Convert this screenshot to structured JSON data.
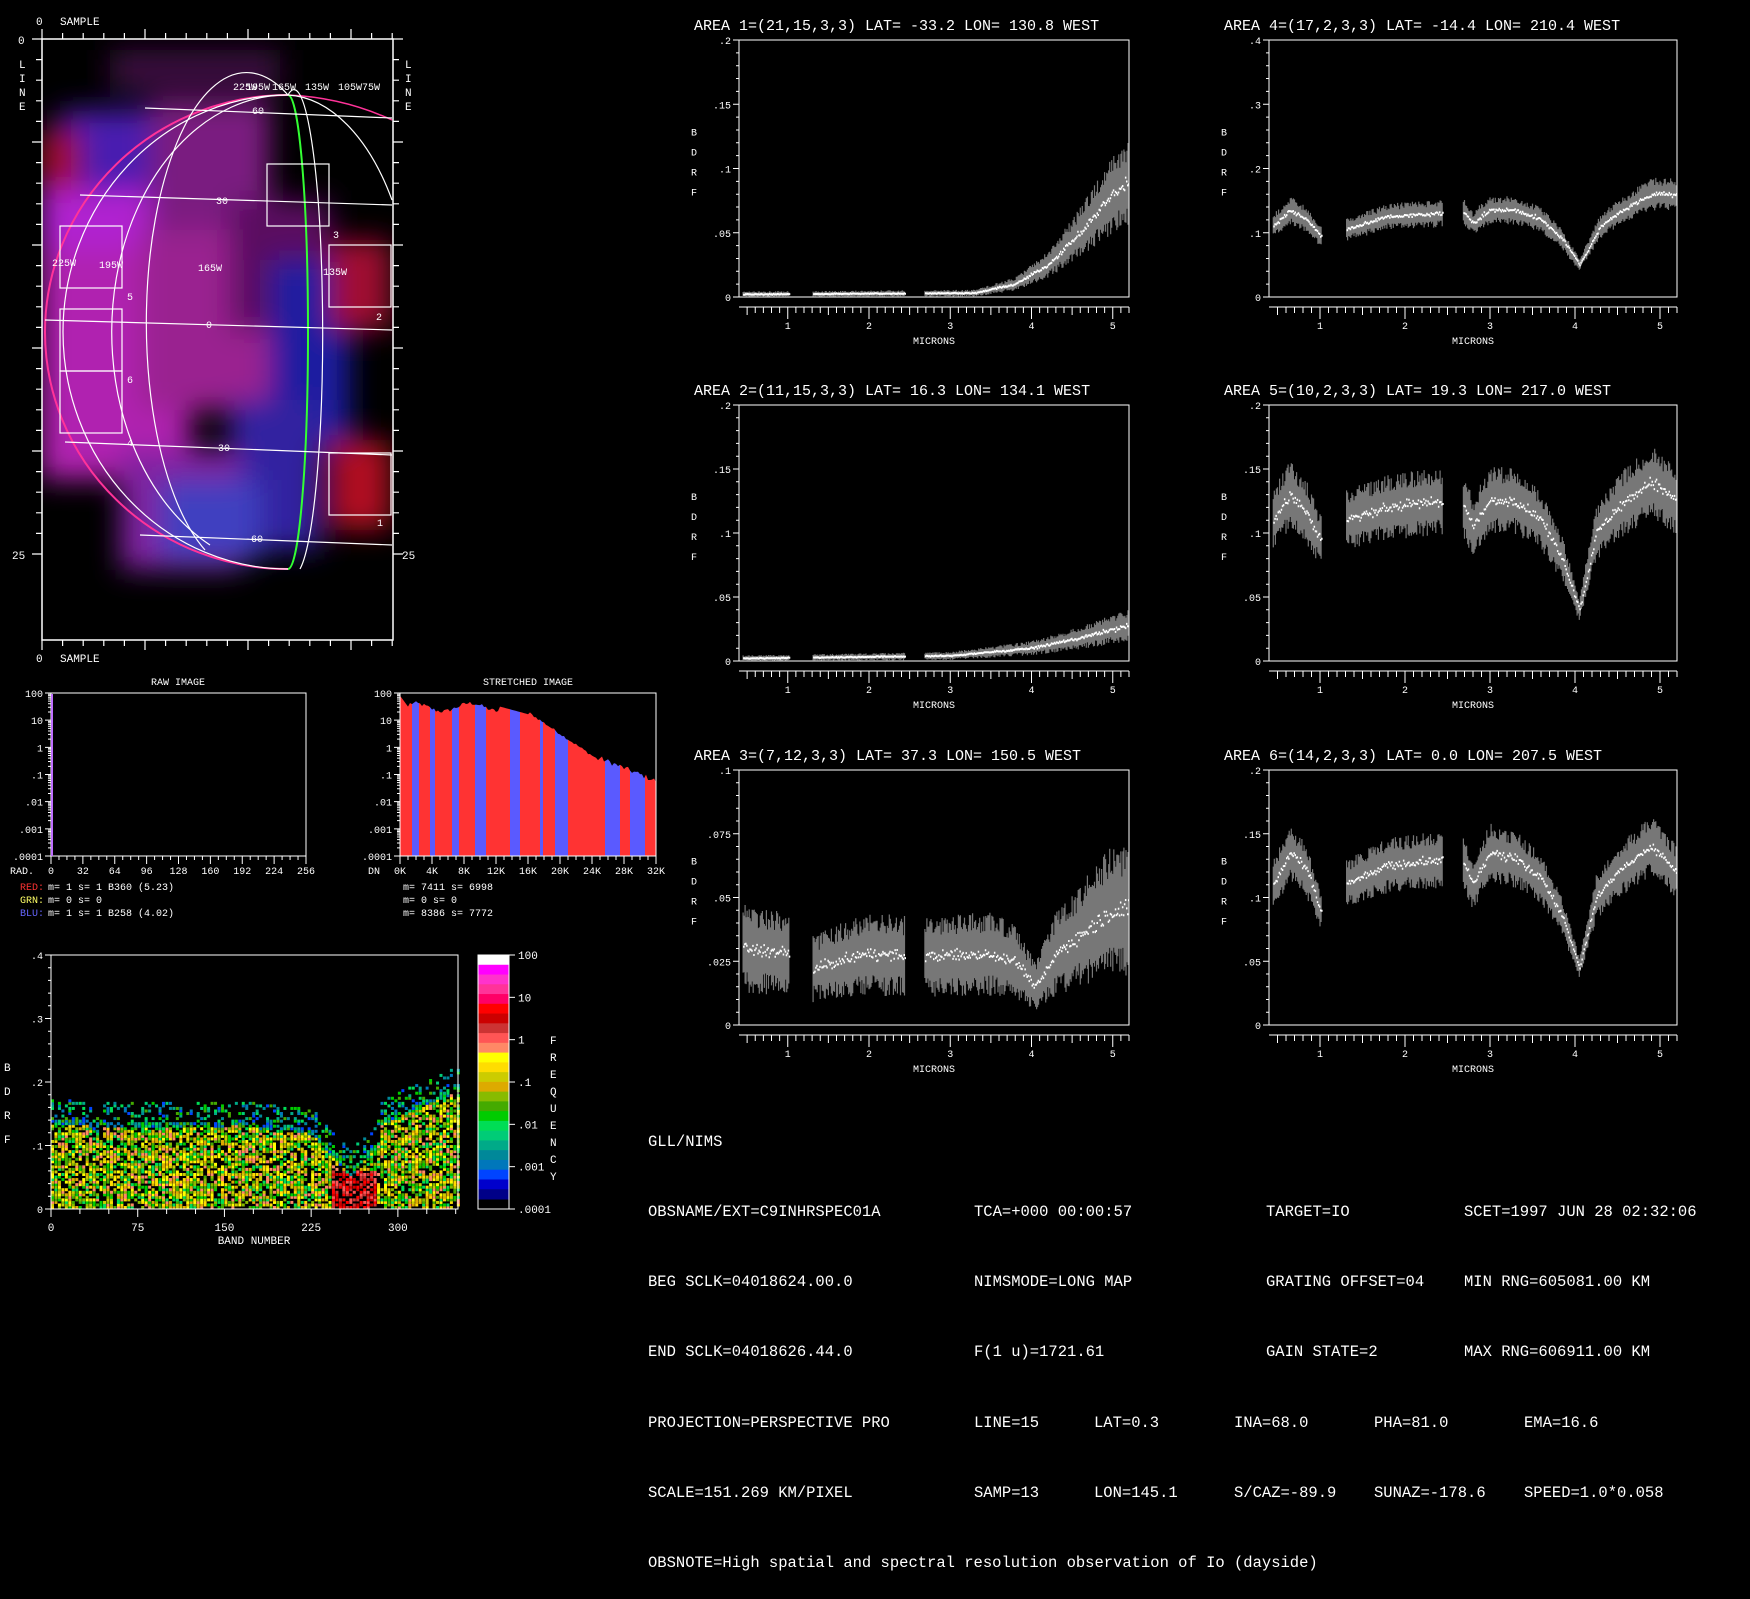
{
  "image_panel": {
    "sample_label": "SAMPLE",
    "line_label": [
      "L",
      "I",
      "N",
      "E"
    ],
    "zero": "0",
    "line_max": "25",
    "lon_labels_top": [
      "225W",
      "195W",
      "165W",
      "135W",
      "105W",
      "75W"
    ],
    "lon_labels_mid": [
      "225W",
      "195W",
      "165W",
      "135W"
    ],
    "lat_labels": [
      "60",
      "30",
      "0",
      "-30",
      "-60"
    ],
    "area_numbers": [
      "1",
      "2",
      "3",
      "4",
      "5",
      "6"
    ],
    "colors": {
      "limb": "#ff3399",
      "terminator": "#33ff33",
      "grid": "#ffffff"
    }
  },
  "hist_raw": {
    "title": "RAW IMAGE",
    "x_label": "RAD.",
    "x_ticks": [
      "0",
      "32",
      "64",
      "96",
      "128",
      "160",
      "192",
      "224",
      "256"
    ],
    "y_ticks": [
      "100",
      "10",
      "1",
      ".1",
      ".01",
      ".001",
      ".0001"
    ]
  },
  "hist_stretched": {
    "title": "STRETCHED IMAGE",
    "x_label": "DN",
    "x_ticks": [
      "0K",
      "4K",
      "8K",
      "12K",
      "16K",
      "20K",
      "24K",
      "28K",
      "32K"
    ],
    "y_ticks": [
      "100",
      "10",
      "1",
      ".1",
      ".01",
      ".001",
      ".0001"
    ]
  },
  "stats": {
    "raw": [
      {
        "ch": "RED:",
        "text": "m=    1 s=    1 B360 (5.23)",
        "color": "#ff3333"
      },
      {
        "ch": "GRN:",
        "text": "m=    0 s=    0",
        "color": "#ffff66"
      },
      {
        "ch": "BLU:",
        "text": "m=    1 s=    1 B258 (4.02)",
        "color": "#6666ff"
      }
    ],
    "stretched": [
      "m= 7411 s= 6998",
      "m=    0 s=    0",
      "m= 8386 s= 7772"
    ]
  },
  "density": {
    "y_label": [
      "B",
      "D",
      "R",
      "F"
    ],
    "x_label": "BAND NUMBER",
    "x_ticks": [
      "0",
      "75",
      "150",
      "225",
      "300"
    ],
    "y_ticks": [
      ".4",
      ".3",
      ".2",
      ".1",
      "0"
    ],
    "colorbar_ticks": [
      "100",
      "10",
      "1",
      ".1",
      ".01",
      ".001",
      ".0001"
    ],
    "colorbar_label": [
      "F",
      "R",
      "E",
      "Q",
      "U",
      "E",
      "N",
      "C",
      "Y"
    ],
    "colorbar_colors": [
      "#ffffff",
      "#ff00ff",
      "#ff33cc",
      "#ff3399",
      "#ff0066",
      "#ff0000",
      "#cc0000",
      "#cc3333",
      "#ff5555",
      "#ff8866",
      "#ffff00",
      "#ffdd00",
      "#cccc00",
      "#ddaa00",
      "#88bb00",
      "#44aa00",
      "#00cc00",
      "#00dd55",
      "#00cc77",
      "#00aa88",
      "#008899",
      "#0077bb",
      "#0044ff",
      "#0000cc",
      "#000088"
    ]
  },
  "spectra_common": {
    "x_label": "MICRONS",
    "y_label": [
      "B",
      "D",
      "R",
      "F"
    ],
    "x_ticks": [
      "1",
      "2",
      "3",
      "4",
      "5"
    ]
  },
  "chart_data": [
    {
      "type": "line",
      "title": "AREA 1=(21,15,3,3) LAT= -33.2 LON= 130.8 WEST",
      "xlabel": "MICRONS",
      "ylabel": "BDRF",
      "xlim": [
        0.4,
        5.2
      ],
      "ylim": [
        0,
        0.2
      ],
      "y_ticks": [
        ".2",
        ".15",
        ".1",
        ".05",
        "0"
      ],
      "noise": 0.18,
      "points": [
        [
          0.45,
          0.002
        ],
        [
          3.3,
          0.003
        ],
        [
          3.8,
          0.01
        ],
        [
          4.2,
          0.025
        ],
        [
          4.6,
          0.05
        ],
        [
          5.0,
          0.08
        ],
        [
          5.2,
          0.09
        ]
      ]
    },
    {
      "type": "line",
      "title": "AREA 2=(11,15,3,3) LAT=  16.3 LON= 134.1 WEST",
      "xlabel": "MICRONS",
      "ylabel": "BDRF",
      "xlim": [
        0.4,
        5.2
      ],
      "ylim": [
        0,
        0.2
      ],
      "y_ticks": [
        ".2",
        ".15",
        ".1",
        ".05",
        "0"
      ],
      "noise": 0.2,
      "points": [
        [
          0.45,
          0.002
        ],
        [
          3.0,
          0.004
        ],
        [
          4.0,
          0.01
        ],
        [
          4.6,
          0.018
        ],
        [
          5.2,
          0.028
        ]
      ]
    },
    {
      "type": "line",
      "title": "AREA 3=(7,12,3,3) LAT=  37.3 LON= 150.5 WEST",
      "xlabel": "MICRONS",
      "ylabel": "BDRF",
      "xlim": [
        0.4,
        5.2
      ],
      "ylim": [
        0,
        0.1
      ],
      "y_ticks": [
        ".1",
        ".075",
        ".05",
        ".025",
        "0"
      ],
      "noise": 0.28,
      "points": [
        [
          0.45,
          0.03
        ],
        [
          1.0,
          0.028
        ],
        [
          1.3,
          0.022
        ],
        [
          2.0,
          0.028
        ],
        [
          2.45,
          0.027
        ],
        [
          2.7,
          0.027
        ],
        [
          3.5,
          0.028
        ],
        [
          3.8,
          0.025
        ],
        [
          4.05,
          0.015
        ],
        [
          4.3,
          0.028
        ],
        [
          4.6,
          0.035
        ],
        [
          5.0,
          0.045
        ],
        [
          5.2,
          0.045
        ]
      ]
    },
    {
      "type": "line",
      "title": "AREA 4=(17,2,3,3) LAT= -14.4 LON= 210.4 WEST",
      "xlabel": "MICRONS",
      "ylabel": "BDRF",
      "xlim": [
        0.4,
        5.2
      ],
      "ylim": [
        0,
        0.4
      ],
      "y_ticks": [
        ".4",
        ".3",
        ".2",
        ".1",
        "0"
      ],
      "noise": 0.07,
      "points": [
        [
          0.45,
          0.11
        ],
        [
          0.65,
          0.135
        ],
        [
          0.85,
          0.12
        ],
        [
          1.0,
          0.095
        ],
        [
          1.3,
          0.105
        ],
        [
          1.8,
          0.125
        ],
        [
          2.45,
          0.13
        ],
        [
          2.7,
          0.13
        ],
        [
          2.8,
          0.115
        ],
        [
          3.0,
          0.135
        ],
        [
          3.3,
          0.135
        ],
        [
          3.6,
          0.12
        ],
        [
          3.85,
          0.09
        ],
        [
          4.05,
          0.05
        ],
        [
          4.3,
          0.11
        ],
        [
          4.5,
          0.13
        ],
        [
          4.9,
          0.16
        ],
        [
          5.2,
          0.16
        ]
      ]
    },
    {
      "type": "line",
      "title": "AREA 5=(10,2,3,3) LAT=  19.3 LON= 217.0 WEST",
      "xlabel": "MICRONS",
      "ylabel": "BDRF",
      "xlim": [
        0.4,
        5.2
      ],
      "ylim": [
        0,
        0.2
      ],
      "y_ticks": [
        ".2",
        ".15",
        ".1",
        ".05",
        "0"
      ],
      "noise": 0.1,
      "points": [
        [
          0.45,
          0.11
        ],
        [
          0.65,
          0.13
        ],
        [
          0.85,
          0.115
        ],
        [
          1.0,
          0.095
        ],
        [
          1.3,
          0.11
        ],
        [
          1.8,
          0.12
        ],
        [
          2.45,
          0.125
        ],
        [
          2.7,
          0.12
        ],
        [
          2.8,
          0.105
        ],
        [
          3.0,
          0.125
        ],
        [
          3.3,
          0.125
        ],
        [
          3.6,
          0.11
        ],
        [
          3.85,
          0.08
        ],
        [
          4.05,
          0.04
        ],
        [
          4.25,
          0.1
        ],
        [
          4.5,
          0.12
        ],
        [
          4.9,
          0.14
        ],
        [
          5.2,
          0.125
        ]
      ]
    },
    {
      "type": "line",
      "title": "AREA 6=(14,2,3,3) LAT=   0.0 LON= 207.5 WEST",
      "xlabel": "MICRONS",
      "ylabel": "BDRF",
      "xlim": [
        0.4,
        5.2
      ],
      "ylim": [
        0,
        0.2
      ],
      "y_ticks": [
        ".2",
        ".15",
        ".1",
        ".05",
        "0"
      ],
      "noise": 0.08,
      "points": [
        [
          0.45,
          0.11
        ],
        [
          0.65,
          0.135
        ],
        [
          0.85,
          0.12
        ],
        [
          1.0,
          0.09
        ],
        [
          1.3,
          0.11
        ],
        [
          1.8,
          0.125
        ],
        [
          2.45,
          0.13
        ],
        [
          2.7,
          0.125
        ],
        [
          2.8,
          0.11
        ],
        [
          3.0,
          0.135
        ],
        [
          3.3,
          0.13
        ],
        [
          3.6,
          0.115
        ],
        [
          3.85,
          0.085
        ],
        [
          4.05,
          0.045
        ],
        [
          4.25,
          0.1
        ],
        [
          4.5,
          0.12
        ],
        [
          4.9,
          0.14
        ],
        [
          5.2,
          0.12
        ]
      ]
    }
  ],
  "info": {
    "header": "GLL/NIMS",
    "rows": [
      [
        "OBSNAME/EXT=C9INHRSPEC01A",
        "TCA=+000 00:00:57",
        "TARGET=IO",
        "SCET=1997 JUN 28 02:32:06"
      ],
      [
        "BEG SCLK=04018624.00.0",
        "NIMSMODE=LONG MAP",
        "GRATING OFFSET=04",
        "MIN RNG=605081.00 KM"
      ],
      [
        "END SCLK=04018626.44.0",
        "F(1 u)=1721.61",
        "GAIN STATE=2",
        "MAX RNG=606911.00 KM"
      ]
    ],
    "rows5": [
      [
        "PROJECTION=PERSPECTIVE PRO",
        "LINE=15",
        "LAT=0.3",
        "INA=68.0",
        "PHA=81.0",
        "EMA=16.6"
      ],
      [
        "SCALE=151.269 KM/PIXEL",
        "SAMP=13",
        "LON=145.1",
        "S/CAZ=-89.9",
        "SUNAZ=-178.6",
        "SPEED=1.0*0.058"
      ]
    ],
    "obsnote": "OBSNOTE=High spatial and spectral resolution observation of Io (dayside)"
  }
}
